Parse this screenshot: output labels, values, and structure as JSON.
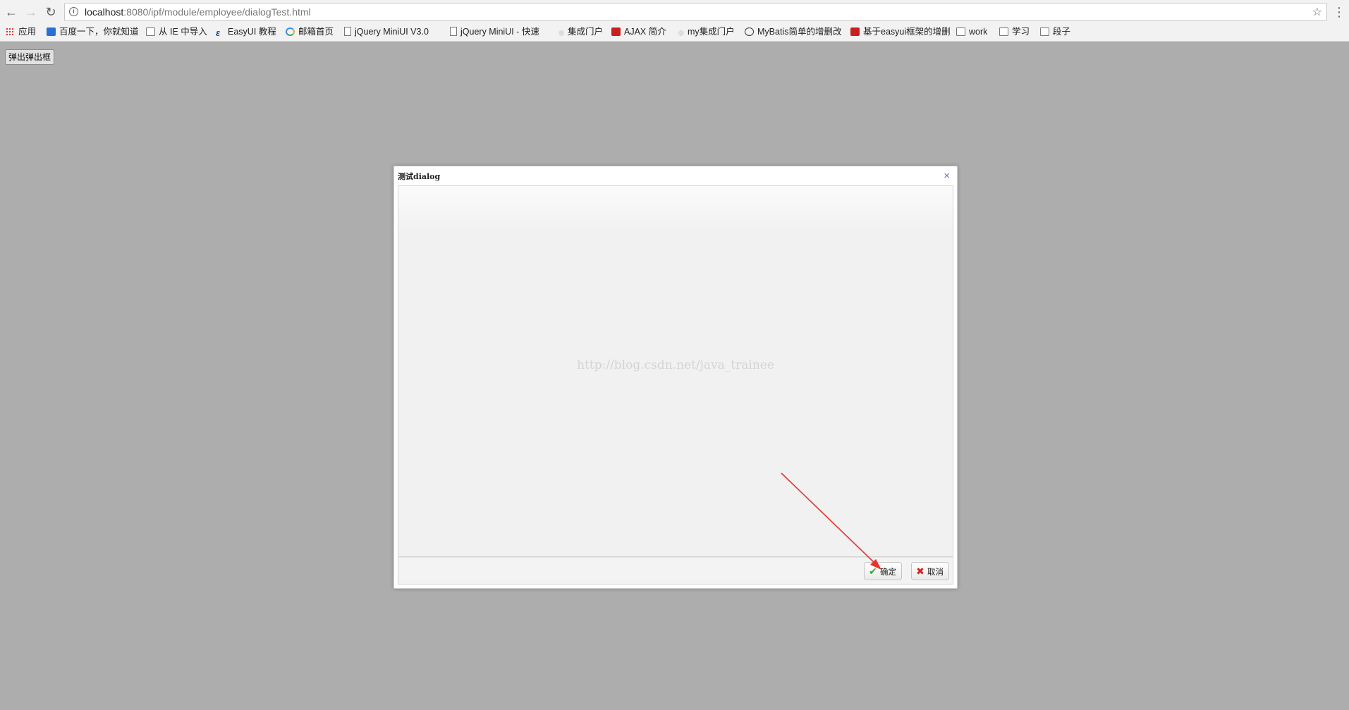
{
  "browser": {
    "url_host": "localhost",
    "url_rest": ":8080/ipf/module/employee/dialogTest.html",
    "bookmarks": [
      {
        "label": "应用",
        "icon": "apps-icon"
      },
      {
        "label": "百度一下，你就知道",
        "icon": "baidu-icon"
      },
      {
        "label": "从 IE 中导入",
        "icon": "folder-icon"
      },
      {
        "label": "EasyUI 教程",
        "icon": "easyui-icon"
      },
      {
        "label": "邮箱首页",
        "icon": "chrome-icon"
      },
      {
        "label": "jQuery MiniUI V3.0",
        "icon": "page-icon"
      },
      {
        "label": "jQuery MiniUI - 快速",
        "icon": "page-icon"
      },
      {
        "label": "集成门户",
        "icon": "site-icon"
      },
      {
        "label": "AJAX 简介",
        "icon": "w3-icon"
      },
      {
        "label": "my集成门户",
        "icon": "site-icon"
      },
      {
        "label": "MyBatis简单的增删改",
        "icon": "github-icon"
      },
      {
        "label": "基于easyui框架的增删",
        "icon": "csdn-icon"
      },
      {
        "label": "work",
        "icon": "folder-icon"
      },
      {
        "label": "学习",
        "icon": "folder-icon"
      },
      {
        "label": "段子",
        "icon": "folder-icon"
      }
    ]
  },
  "page": {
    "open_button_label": "弹出弹出框"
  },
  "dialog": {
    "title": "测试dialog",
    "close_glyph": "×",
    "watermark": "http://blog.csdn.net/java_trainee",
    "ok_label": "确定",
    "cancel_label": "取消",
    "ok_icon_glyph": "✔",
    "cancel_icon_glyph": "✖"
  },
  "annotation": {
    "arrow_color": "#e8322d"
  }
}
